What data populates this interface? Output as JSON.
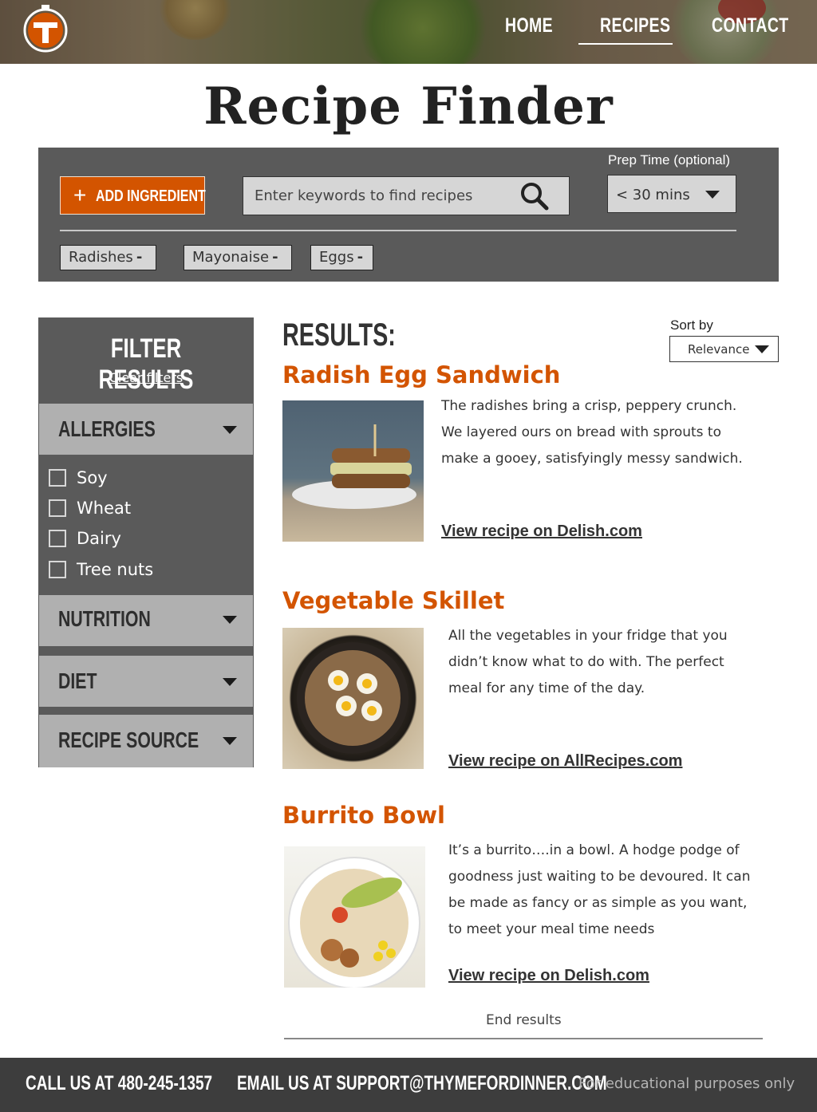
{
  "header": {
    "nav": {
      "home": "HOME",
      "recipes": "RECIPES",
      "contact": "CONTACT"
    },
    "active_nav": "recipes"
  },
  "page_title": "Recipe Finder",
  "search": {
    "add_ingredient_label": "ADD INGREDIENT",
    "keywords_placeholder": "Enter keywords to find recipes",
    "prep_time_label": "Prep Time (optional)",
    "prep_time_value": "< 30 mins",
    "chips": [
      "Radishes",
      "Mayonaise",
      "Eggs"
    ],
    "chip_remove_symbol": "-"
  },
  "filter": {
    "title": "FILTER RESULTS",
    "clear_label": "Clear filters",
    "sections": {
      "allergies": "ALLERGIES",
      "nutrition": "NUTRITION",
      "diet": "DIET",
      "recipe_source": "RECIPE SOURCE"
    },
    "allergies_options": [
      "Soy",
      "Wheat",
      "Dairy",
      "Tree nuts"
    ]
  },
  "results": {
    "title": "RESULTS:",
    "sort_label": "Sort by",
    "sort_value": "Relevance",
    "items": [
      {
        "title": "Radish Egg Sandwich",
        "description": "The radishes bring a crisp, peppery crunch. We layered ours on bread with sprouts to make a gooey, satisfyingly messy sandwich.",
        "link": "View recipe on Delish.com"
      },
      {
        "title": "Vegetable Skillet",
        "description": "All the vegetables in your fridge that you didn’t know what to do with. The perfect meal for any time of the day.",
        "link": "View recipe on AllRecipes.com"
      },
      {
        "title": "Burrito Bowl",
        "description": "It’s a burrito….in a bowl. A hodge podge of goodness just waiting to be devoured. It can be made as fancy or as simple as you want, to meet your meal time needs",
        "link": "View recipe on Delish.com"
      }
    ],
    "end_label": "End results"
  },
  "footer": {
    "call": "CALL US AT 480-245-1357",
    "email": "EMAIL US AT SUPPORT@THYMEFORDINNER.COM",
    "note": "For educational purposes only"
  },
  "colors": {
    "accent": "#d35400",
    "panel": "#5a5a5a",
    "section_header": "#b0b0b0",
    "footer": "#3d3d3d"
  }
}
